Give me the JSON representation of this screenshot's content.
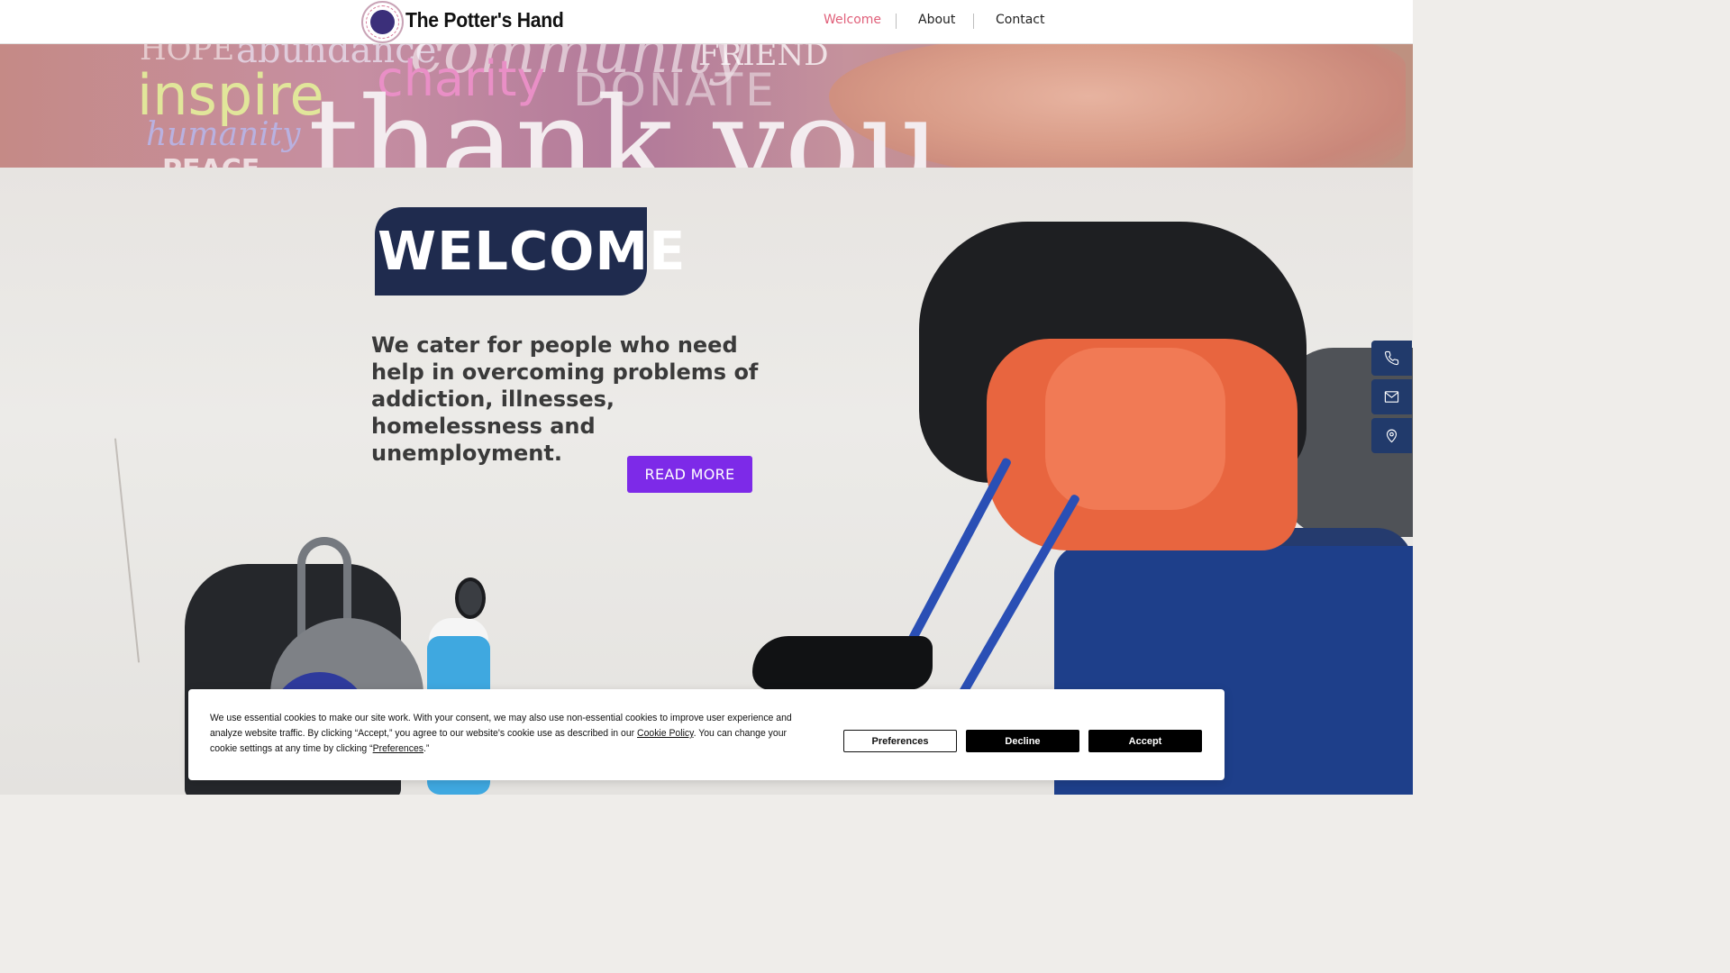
{
  "header": {
    "brand": "The Potter's Hand",
    "nav": [
      {
        "label": "Welcome",
        "active": true
      },
      {
        "label": "About",
        "active": false
      },
      {
        "label": "Contact",
        "active": false
      }
    ]
  },
  "banner": {
    "words": [
      "HOPE",
      "abundance",
      "community",
      "FRIEND",
      "inspire",
      "charity",
      "DONATE",
      "humanity",
      "thank you",
      "PEACE"
    ]
  },
  "hero": {
    "heading": "WELCOME",
    "tagline": "We cater for people who need help in overcoming problems of addiction, illnesses, homelessness and unemployment.",
    "cta_label": "READ MORE"
  },
  "side_contact": {
    "icons": [
      "phone-icon",
      "mail-icon",
      "location-pin-icon"
    ]
  },
  "cookie_banner": {
    "text_before_policy": "We use essential cookies to make our site work. With your consent, we may also use non-essential cookies to improve user experience and analyze website traffic. By clicking “Accept,” you agree to our website's cookie use as described in our ",
    "policy_link": "Cookie Policy",
    "text_after_policy": ". You can change your cookie settings at any time by clicking “",
    "preferences_link": "Preferences",
    "text_end": ".”",
    "buttons": {
      "preferences": "Preferences",
      "decline": "Decline",
      "accept": "Accept"
    }
  },
  "colors": {
    "nav_active": "#e0607a",
    "welcome_box": "#1f2b4e",
    "cta": "#7d2ae8",
    "side_buttons": "#213a6b"
  }
}
